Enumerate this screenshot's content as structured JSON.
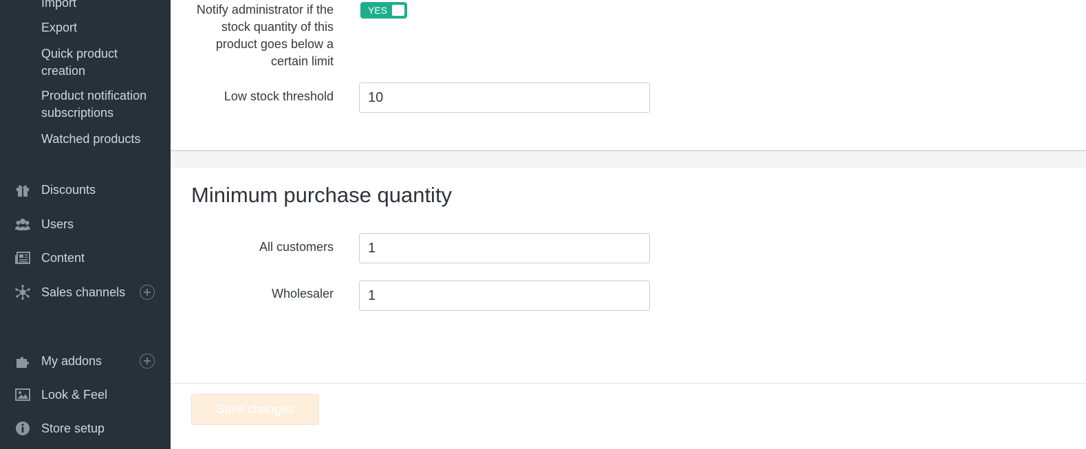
{
  "sidebar": {
    "sub_items": [
      {
        "label": "Import"
      },
      {
        "label": "Export"
      },
      {
        "label": "Quick product creation"
      },
      {
        "label": "Product notification subscriptions"
      },
      {
        "label": "Watched products"
      }
    ],
    "nav_items": [
      {
        "label": "Discounts",
        "icon": "gift-icon"
      },
      {
        "label": "Users",
        "icon": "users-icon"
      },
      {
        "label": "Content",
        "icon": "newspaper-icon"
      },
      {
        "label": "Sales channels",
        "icon": "network-icon",
        "has_add": true
      },
      {
        "label": "My addons",
        "icon": "puzzle-icon",
        "has_add": true
      },
      {
        "label": "Look & Feel",
        "icon": "image-icon"
      },
      {
        "label": "Store setup",
        "icon": "info-icon"
      }
    ]
  },
  "inventory": {
    "notify_label": "Notify administrator if the stock quantity of this product goes below a certain limit",
    "notify_toggle": "YES",
    "threshold_label": "Low stock threshold",
    "threshold_value": "10"
  },
  "min_purchase": {
    "title": "Minimum purchase quantity",
    "all_customers_label": "All customers",
    "all_customers_value": "1",
    "wholesaler_label": "Wholesaler",
    "wholesaler_value": "1"
  },
  "footer": {
    "save_label": "Save changes"
  },
  "colors": {
    "sidebar_bg": "#263238",
    "toggle_on": "#1fae8c",
    "save_disabled": "#fdefdc"
  }
}
